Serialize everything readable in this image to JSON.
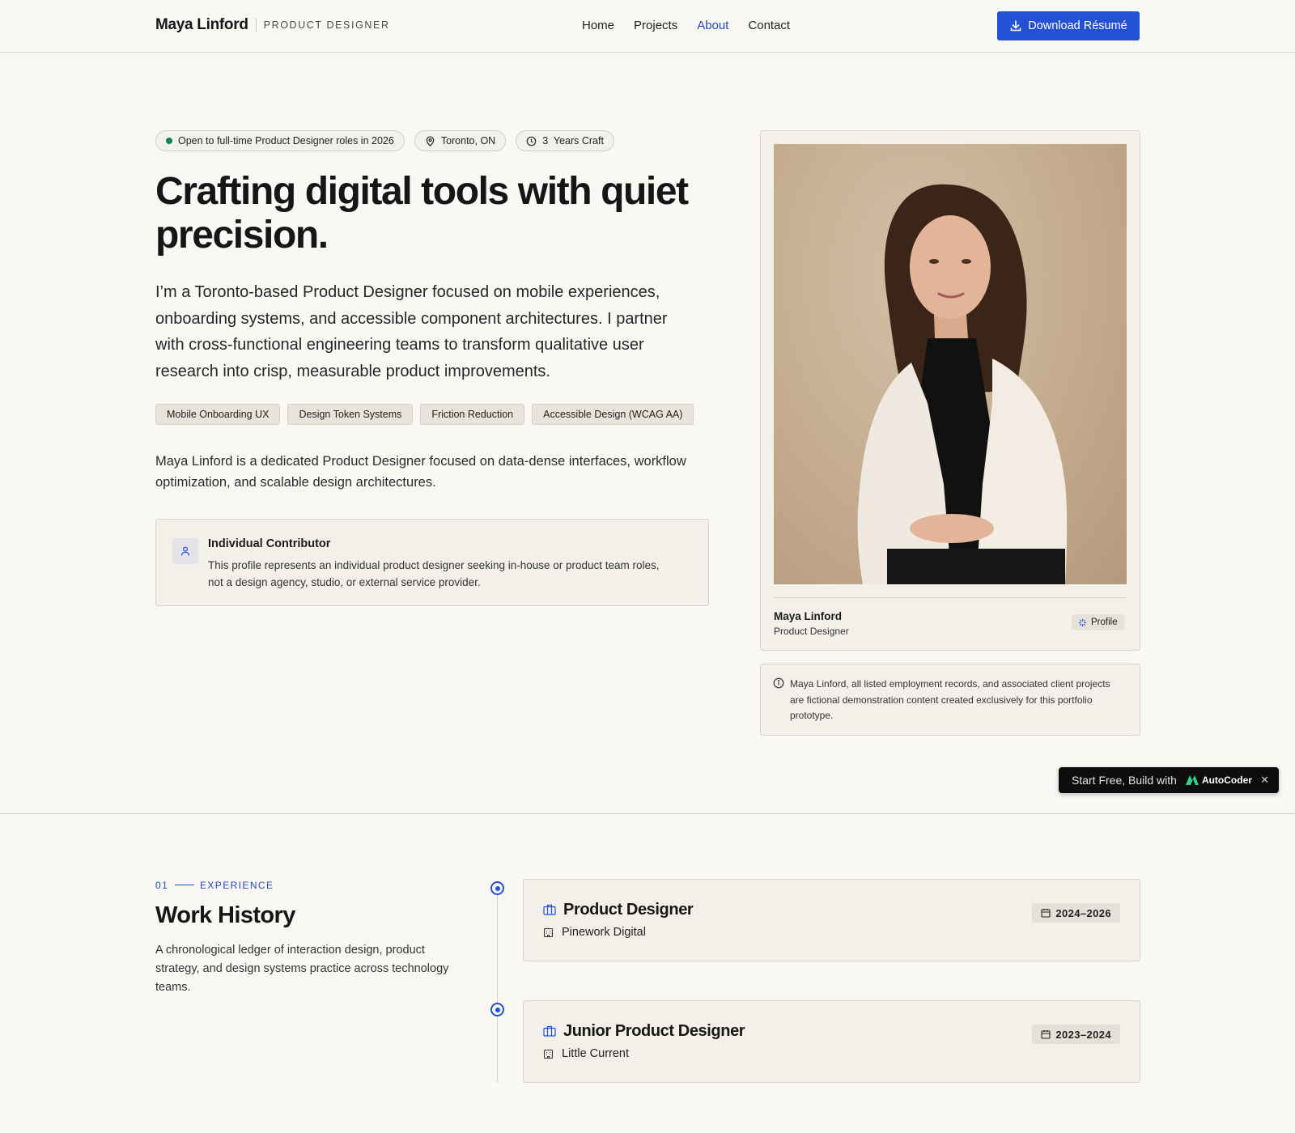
{
  "header": {
    "brand_name": "Maya Linford",
    "brand_role": "PRODUCT DESIGNER",
    "nav": [
      "Home",
      "Projects",
      "About",
      "Contact"
    ],
    "active_nav": "About",
    "download_label": "Download Résumé"
  },
  "hero": {
    "chips": [
      {
        "icon": "status-dot",
        "label": "Open to full-time Product Designer roles in 2026"
      },
      {
        "icon": "location-pin-icon",
        "label": "Toronto, ON"
      },
      {
        "icon": "clock-icon",
        "label": "3  Years Craft"
      }
    ],
    "title": "Crafting digital tools with quiet precision.",
    "lead": "I’m a Toronto-based Product Designer focused on mobile experiences, onboarding systems, and accessible component architectures. I partner with cross-functional engineering teams to transform qualitative user research into crisp, measurable product improvements.",
    "tags": [
      "Mobile Onboarding UX",
      "Design Token Systems",
      "Friction Reduction",
      "Accessible Design (WCAG AA)"
    ],
    "bio": "Maya Linford is a dedicated Product Designer focused on data-dense interfaces, workflow optimization, and scalable design architectures.",
    "contributor": {
      "title": "Individual Contributor",
      "text": "This profile represents an individual product designer seeking in-house or product team roles, not a design agency, studio, or external service provider."
    }
  },
  "profile_card": {
    "name": "Maya Linford",
    "role": "Product Designer",
    "badge": "Profile"
  },
  "disclaimer": "Maya Linford, all listed employment records, and associated client projects are fictional demonstration content created exclusively for this portfolio prototype.",
  "promo": {
    "text": "Start Free, Build with",
    "brand": "AutoCoder",
    "close": "✕"
  },
  "experience": {
    "number": "01",
    "label": "EXPERIENCE",
    "title": "Work History",
    "description": "A chronological ledger of interaction design, product strategy, and design systems practice across technology teams.",
    "jobs": [
      {
        "title": "Product Designer",
        "company": "Pinework Digital",
        "dates": "2024–2026"
      },
      {
        "title": "Junior Product Designer",
        "company": "Little Current",
        "dates": "2023–2024"
      }
    ]
  },
  "colors": {
    "accent": "#2350d4",
    "status_green": "#14804f",
    "background": "#f9f8f5",
    "card": "#f3f0ea"
  }
}
